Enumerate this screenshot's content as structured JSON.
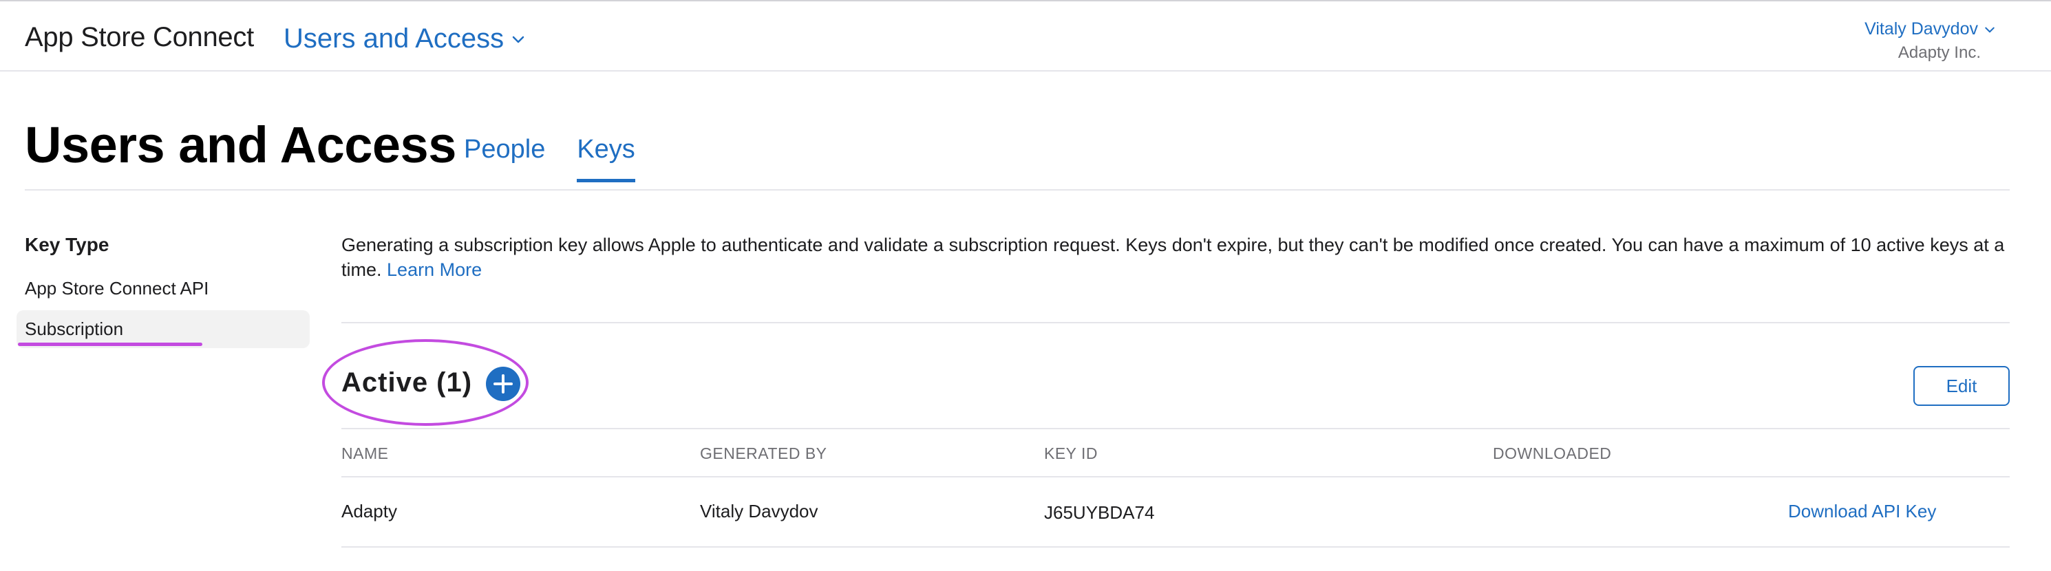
{
  "topbar": {
    "brand": "App Store Connect",
    "section": "Users and Access",
    "user_name": "Vitaly Davydov",
    "user_org": "Adapty Inc."
  },
  "header": {
    "title": "Users and Access",
    "tabs": [
      {
        "label": "People",
        "active": false
      },
      {
        "label": "Keys",
        "active": true
      }
    ]
  },
  "sidebar": {
    "heading": "Key Type",
    "items": [
      {
        "label": "App Store Connect API",
        "selected": false
      },
      {
        "label": "Subscription",
        "selected": true
      }
    ]
  },
  "main": {
    "description": "Generating a subscription key allows Apple to authenticate and validate a subscription request. Keys don't expire, but they can't be modified once created. You can have a maximum of 10 active keys at a time.",
    "learn_more": "Learn More",
    "active_title": "Active (1)",
    "edit_label": "Edit",
    "table": {
      "columns": [
        "NAME",
        "GENERATED BY",
        "KEY ID",
        "DOWNLOADED"
      ],
      "rows": [
        {
          "name": "Adapty",
          "generated_by": "Vitaly Davydov",
          "key_id": "J65UYBDA74",
          "downloaded": "",
          "action": "Download API Key"
        }
      ]
    }
  },
  "colors": {
    "accent": "#1f6ec2",
    "annotation": "#c34be0"
  }
}
